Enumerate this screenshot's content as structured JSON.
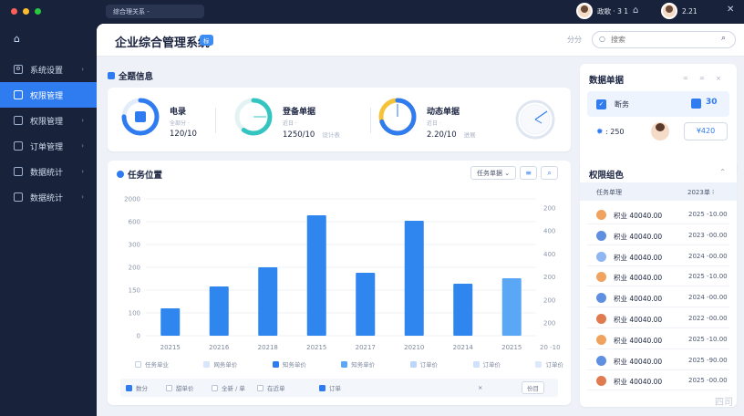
{
  "topbar": {
    "tab_search": "综合理关系 -",
    "user1": "政歌 · 3 1",
    "user2": "2.21",
    "cart_icon": "cart-icon",
    "close_icon": "close-icon"
  },
  "sidebar": {
    "home_icon": "home-icon",
    "items": [
      {
        "label": "系统设置",
        "icon": "settings-icon",
        "active": false
      },
      {
        "label": "权限管理",
        "icon": "shield-icon",
        "active": true
      },
      {
        "label": "权限管理",
        "icon": "doc-icon",
        "active": false
      },
      {
        "label": "订单管理",
        "icon": "order-icon",
        "active": false
      },
      {
        "label": "数据统计",
        "icon": "chart-icon",
        "active": false
      },
      {
        "label": "数据统计",
        "icon": "shield-icon",
        "active": false
      }
    ]
  },
  "header": {
    "title": "企业综合管理系统",
    "badge": "标",
    "label": "分分",
    "search_placeholder": "搜索"
  },
  "overview": {
    "title": "全题信息",
    "stats": [
      {
        "label": "电录",
        "sub": "全部分 ·",
        "value": "120/10",
        "muted": "",
        "progress": 0.75,
        "color": "#2f7bf0"
      },
      {
        "label": "登备单据",
        "sub": "近日 ·",
        "value": "1250/10",
        "muted": "设计表",
        "progress": 0.6,
        "color": "#34c5c0"
      },
      {
        "label": "动态单据",
        "sub": "近日 ·",
        "value": "2.20/10",
        "muted": "进展",
        "progress": 0.7,
        "color": "#2f7bf0"
      }
    ]
  },
  "chart_section": {
    "title": "任务位置",
    "select": "任务单据",
    "legend": [
      "任务单业",
      "网务单价",
      "知务单价",
      "知务单价",
      "订单价",
      "订单价",
      "订单价"
    ],
    "filters": [
      "数分",
      "甜单价",
      "全新 / 单",
      "在近单",
      "订单",
      "×",
      "份目"
    ]
  },
  "chart_data": {
    "type": "bar",
    "categories": [
      "20215",
      "20216",
      "20218",
      "20215",
      "20217",
      "20210",
      "20214",
      "20215"
    ],
    "values": [
      100,
      180,
      250,
      440,
      230,
      420,
      190,
      210
    ],
    "y_left_ticks": [
      "0",
      "100",
      "150",
      "200",
      "300",
      "600",
      "2000"
    ],
    "y_right_ticks": [
      "200",
      "400",
      "400",
      "200",
      "200",
      "200"
    ],
    "right_axis_end": "20 -10",
    "ylim": [
      0,
      500
    ]
  },
  "data_card": {
    "title": "数据单据",
    "row_label": "断务",
    "row_value": "30",
    "icon_value": ": 250",
    "pill": "¥420"
  },
  "perm_card": {
    "title": "权限组色",
    "col1": "任务单理",
    "col2": "2023单",
    "rows": [
      {
        "name": "积业 40040.00",
        "date": "2025 -10.00",
        "color": "#f0a35e"
      },
      {
        "name": "积业 40040.00",
        "date": "2023 -00.00",
        "color": "#5f8fe0"
      },
      {
        "name": "积业 40040.00",
        "date": "2024 -00.00",
        "color": "#8fb6f0"
      },
      {
        "name": "积业 40040.00",
        "date": "2025 -10.00",
        "color": "#f0a35e"
      },
      {
        "name": "积业 40040.00",
        "date": "2024 -00.00",
        "color": "#5f8fe0"
      },
      {
        "name": "积业 40040.00",
        "date": "2022 -00.00",
        "color": "#e07a4f"
      },
      {
        "name": "积业 40040.00",
        "date": "2025 -10.00",
        "color": "#f0a35e"
      },
      {
        "name": "积业 40040.00",
        "date": "2025 -90.00",
        "color": "#5f8fe0"
      },
      {
        "name": "积业 40040.00",
        "date": "2025 -00.00",
        "color": "#e07a4f"
      }
    ]
  },
  "watermark": "四司",
  "colors": {
    "accent": "#2f7bf0",
    "sidebar": "#18223a",
    "bar": "#2f86ee",
    "bar_light": "#5aa8f5"
  }
}
